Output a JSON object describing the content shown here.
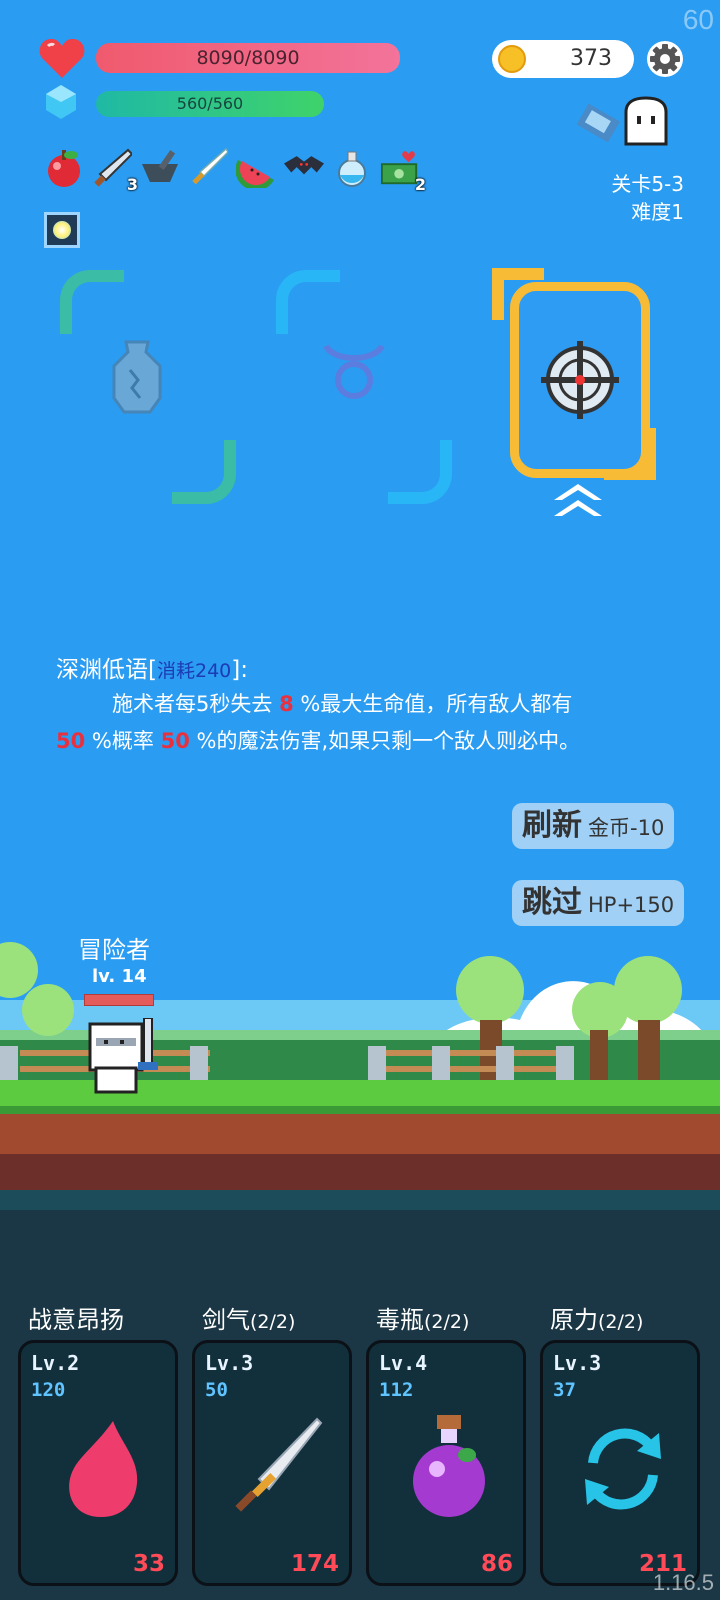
{
  "fps": "60",
  "player": {
    "hp": "8090/8090",
    "mp": "560/560"
  },
  "gold": "373",
  "stage": {
    "level": "关卡5-3",
    "difficulty": "难度1"
  },
  "items": [
    {
      "icon": "apple-icon",
      "count": ""
    },
    {
      "icon": "sword-icon",
      "count": "3"
    },
    {
      "icon": "mortar-icon",
      "count": ""
    },
    {
      "icon": "blade-icon",
      "count": ""
    },
    {
      "icon": "watermelon-icon",
      "count": ""
    },
    {
      "icon": "bat-icon",
      "count": ""
    },
    {
      "icon": "potion-flask-icon",
      "count": ""
    },
    {
      "icon": "money-heart-icon",
      "count": "2"
    }
  ],
  "relic": {
    "icon": "glowing-gem-icon"
  },
  "cards": [
    {
      "icon": "broken-vase-icon"
    },
    {
      "icon": "taurus-icon"
    },
    {
      "icon": "crosshair-icon",
      "selected": true
    }
  ],
  "skill_desc": {
    "name": "深渊低语",
    "cost_open": "[",
    "cost": "消耗240",
    "cost_close": "]:",
    "line1_a": "施术者每5秒失去",
    "line1_num": "8",
    "line1_b": "%最大生命值，所有敌人都有",
    "line2_num1": "50",
    "line2_a": "%概率",
    "line2_num2": "50",
    "line2_b": "%的魔法伤害,如果只剩一个敌人则必中。"
  },
  "buttons": {
    "refresh": {
      "label": "刷新",
      "cost": "金币-10"
    },
    "skip": {
      "label": "跳过",
      "bonus": "HP+150"
    }
  },
  "hero": {
    "name": "冒险者",
    "level": "lv. 14"
  },
  "skills": [
    {
      "name": "战意昂扬",
      "count": "",
      "level": "Lv.2",
      "power": "120",
      "cost": "33",
      "icon": "flame-icon"
    },
    {
      "name": "剑气",
      "count": "(2/2)",
      "level": "Lv.3",
      "power": "50",
      "cost": "174",
      "icon": "sword-icon"
    },
    {
      "name": "毒瓶",
      "count": "(2/2)",
      "level": "Lv.4",
      "power": "112",
      "cost": "86",
      "icon": "poison-bottle-icon"
    },
    {
      "name": "原力",
      "count": "(2/2)",
      "level": "Lv.3",
      "power": "37",
      "cost": "211",
      "icon": "cycle-arrows-icon"
    }
  ],
  "version": "1.16.5",
  "colors": {
    "background": "#2a9cf2",
    "accent_gold": "#f7bb36",
    "damage_red": "#e8303f",
    "card_bg": "#12303c"
  }
}
